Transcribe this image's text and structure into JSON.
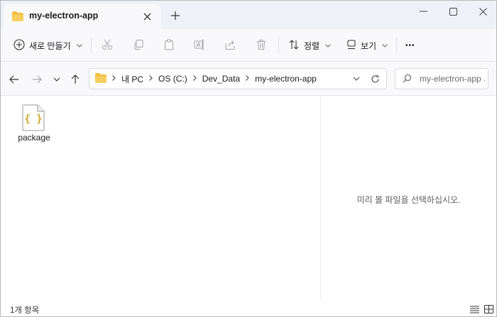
{
  "window": {
    "tab_title": "my-electron-app",
    "new_tab_symbol": "+"
  },
  "toolbar": {
    "new_label": "새로 만들기",
    "sort_label": "정렬",
    "view_label": "보기",
    "more_symbol": "•••"
  },
  "address": {
    "crumbs": [
      "내 PC",
      "OS (C:)",
      "Dev_Data",
      "my-electron-app"
    ]
  },
  "search": {
    "placeholder": "my-electron-app ..."
  },
  "content": {
    "items": [
      {
        "name": "package",
        "icon": "json-file-icon"
      }
    ]
  },
  "preview": {
    "message": "미리 볼 파일을 선택하십시오."
  },
  "status": {
    "count_text": "1개 항목"
  },
  "colors": {
    "folder": "#f2c04a",
    "title_bg": "#eef1f7",
    "toolbar_bg": "#f9f9fb",
    "json_brace": "#c9a227"
  }
}
